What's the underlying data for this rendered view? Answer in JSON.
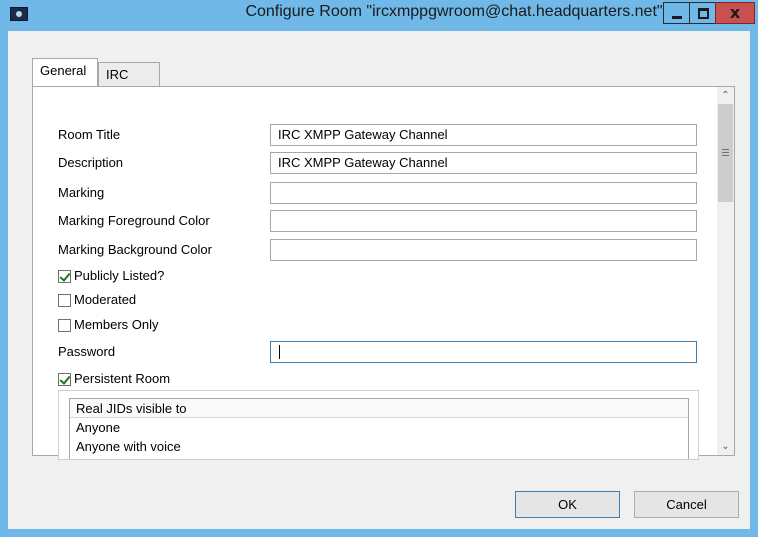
{
  "window": {
    "title": "Configure Room \"ircxmppgwroom@chat.headquarters.net\""
  },
  "tabs": [
    {
      "label": "General",
      "selected": true
    },
    {
      "label": "IRC",
      "selected": false
    }
  ],
  "form": {
    "room_title": {
      "label": "Room Title",
      "value": "IRC XMPP Gateway Channel"
    },
    "description": {
      "label": "Description",
      "value": "IRC XMPP Gateway Channel"
    },
    "marking": {
      "label": "Marking",
      "value": ""
    },
    "marking_fg": {
      "label": "Marking Foreground Color",
      "value": ""
    },
    "marking_bg": {
      "label": "Marking Background Color",
      "value": ""
    },
    "publicly_listed": {
      "label": "Publicly Listed?",
      "checked": true
    },
    "moderated": {
      "label": "Moderated",
      "checked": false
    },
    "members_only": {
      "label": "Members Only",
      "checked": false
    },
    "password": {
      "label": "Password",
      "value": ""
    },
    "persistent_room": {
      "label": "Persistent Room",
      "checked": true
    }
  },
  "jid_list": {
    "header": "Real JIDs visible to",
    "items": [
      "Anyone",
      "Anyone with voice"
    ]
  },
  "buttons": {
    "ok": "OK",
    "cancel": "Cancel"
  },
  "icons": {
    "app": "app-icon",
    "minimize": "minimize-icon",
    "maximize": "maximize-icon",
    "close": "close-icon",
    "scroll_up": "scroll-up-arrow-icon",
    "scroll_down": "scroll-down-arrow-icon"
  }
}
